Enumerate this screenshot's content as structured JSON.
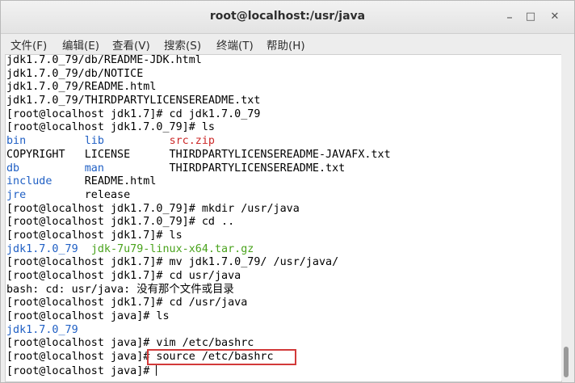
{
  "window": {
    "title": "root@localhost:/usr/java",
    "minimize_label": "–",
    "maximize_label": "□",
    "close_label": "✕"
  },
  "menu": [
    {
      "label": "文件(F)"
    },
    {
      "label": "编辑(E)"
    },
    {
      "label": "查看(V)"
    },
    {
      "label": "搜索(S)"
    },
    {
      "label": "终端(T)"
    },
    {
      "label": "帮助(H)"
    }
  ],
  "terminal": {
    "lines": [
      {
        "segments": [
          {
            "text": "jdk1.7.0_79/db/README-JDK.html"
          }
        ]
      },
      {
        "segments": [
          {
            "text": "jdk1.7.0_79/db/NOTICE"
          }
        ]
      },
      {
        "segments": [
          {
            "text": "jdk1.7.0_79/README.html"
          }
        ]
      },
      {
        "segments": [
          {
            "text": "jdk1.7.0_79/THIRDPARTYLICENSEREADME.txt"
          }
        ]
      },
      {
        "segments": [
          {
            "text": "[root@localhost jdk1.7]# cd jdk1.7.0_79"
          }
        ]
      },
      {
        "segments": [
          {
            "text": "[root@localhost jdk1.7.0_79]# ls"
          }
        ]
      },
      {
        "segments": [
          {
            "text": "bin",
            "color": "blue"
          },
          {
            "text": "         "
          },
          {
            "text": "lib",
            "color": "blue"
          },
          {
            "text": "          "
          },
          {
            "text": "src.zip",
            "color": "red"
          }
        ]
      },
      {
        "segments": [
          {
            "text": "COPYRIGHT   LICENSE      THIRDPARTYLICENSEREADME-JAVAFX.txt"
          }
        ]
      },
      {
        "segments": [
          {
            "text": "db",
            "color": "blue"
          },
          {
            "text": "          "
          },
          {
            "text": "man",
            "color": "blue"
          },
          {
            "text": "          THIRDPARTYLICENSEREADME.txt"
          }
        ]
      },
      {
        "segments": [
          {
            "text": "include",
            "color": "blue"
          },
          {
            "text": "     README.html"
          }
        ]
      },
      {
        "segments": [
          {
            "text": "jre",
            "color": "blue"
          },
          {
            "text": "         release"
          }
        ]
      },
      {
        "segments": [
          {
            "text": "[root@localhost jdk1.7.0_79]# mkdir /usr/java"
          }
        ]
      },
      {
        "segments": [
          {
            "text": "[root@localhost jdk1.7.0_79]# cd .."
          }
        ]
      },
      {
        "segments": [
          {
            "text": "[root@localhost jdk1.7]# ls"
          }
        ]
      },
      {
        "segments": [
          {
            "text": "jdk1.7.0_79",
            "color": "blue"
          },
          {
            "text": "  "
          },
          {
            "text": "jdk-7u79-linux-x64.tar.gz",
            "color": "green"
          }
        ]
      },
      {
        "segments": [
          {
            "text": "[root@localhost jdk1.7]# mv jdk1.7.0_79/ /usr/java/"
          }
        ]
      },
      {
        "segments": [
          {
            "text": "[root@localhost jdk1.7]# cd usr/java"
          }
        ]
      },
      {
        "segments": [
          {
            "text": "bash: cd: usr/java: 没有那个文件或目录"
          }
        ]
      },
      {
        "segments": [
          {
            "text": "[root@localhost jdk1.7]# cd /usr/java"
          }
        ]
      },
      {
        "segments": [
          {
            "text": "[root@localhost java]# ls"
          }
        ]
      },
      {
        "segments": [
          {
            "text": "jdk1.7.0_79",
            "color": "blue"
          }
        ]
      },
      {
        "segments": [
          {
            "text": "[root@localhost java]# vim /etc/bashrc"
          }
        ]
      },
      {
        "segments": [
          {
            "text": "[root@localhost java]# source /etc/bashrc"
          }
        ]
      },
      {
        "segments": [
          {
            "text": "[root@localhost java]# "
          }
        ],
        "cursor": true
      }
    ]
  },
  "colors": {
    "directory": "#1f5fc4",
    "archive": "#cc2a2a",
    "tarball": "#4aa31d",
    "highlight_box": "#d23a3a"
  },
  "icons": [
    "minimize-icon",
    "maximize-icon",
    "close-icon"
  ]
}
